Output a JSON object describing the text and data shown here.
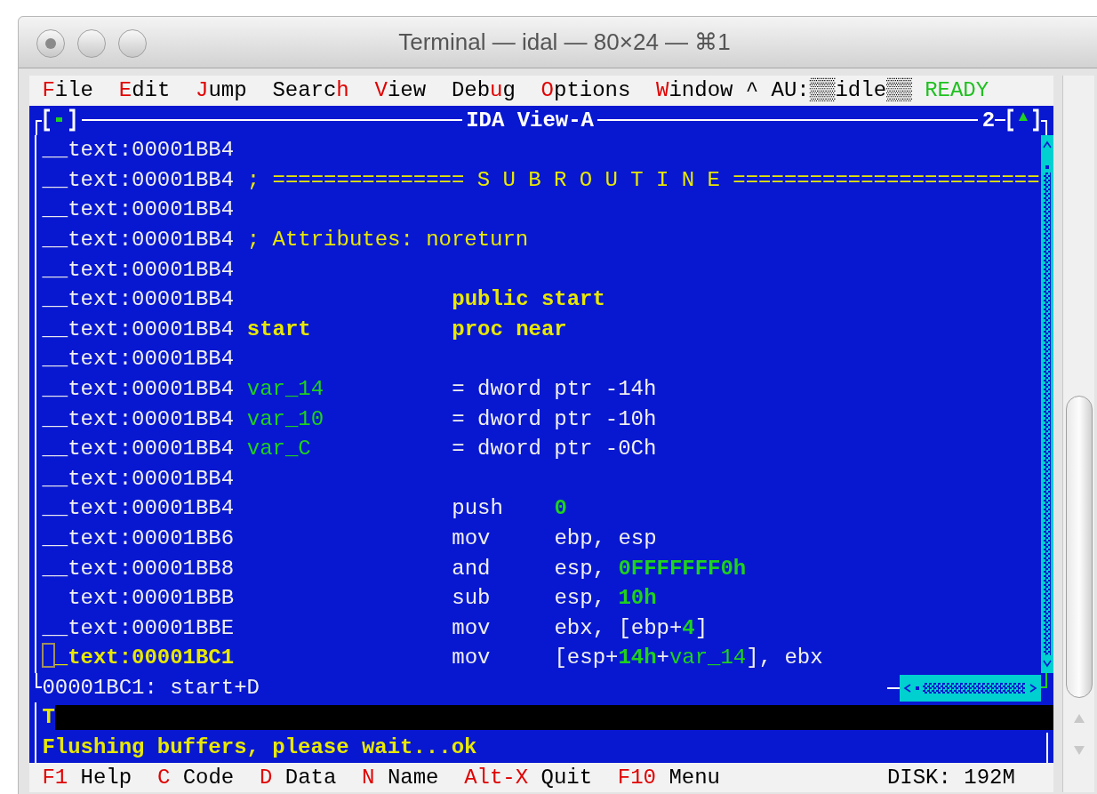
{
  "window": {
    "title": "Terminal — idal — 80×24 — ⌘1"
  },
  "menu": [
    {
      "key": "F",
      "post": "ile"
    },
    {
      "key": "E",
      "post": "dit"
    },
    {
      "key": "J",
      "post": "ump"
    },
    {
      "pre": "Searc",
      "key": "h"
    },
    {
      "key": "V",
      "post": "iew"
    },
    {
      "pre": "Deb",
      "key": "u",
      "post": "g"
    },
    {
      "key": "O",
      "post": "ptions"
    },
    {
      "key": "W",
      "post": "indow"
    }
  ],
  "auto_analysis": "^ AU:▒▒idle▒▒",
  "state": "READY",
  "view": {
    "title": "IDA View-A",
    "window_number": "2"
  },
  "rows": [
    {
      "address": "__text:00001BB4",
      "current": false
    },
    {
      "address": "__text:00001BB4",
      "current": false,
      "comment": "; =============== S U B R O U T I N E ========================"
    },
    {
      "address": "__text:00001BB4",
      "current": false
    },
    {
      "address": "__text:00001BB4",
      "current": false,
      "comment": "; Attributes: noreturn"
    },
    {
      "address": "__text:00001BB4",
      "current": false
    },
    {
      "address": "__text:00001BB4",
      "current": false,
      "directive": [
        {
          "text": "public start",
          "kind": "name"
        }
      ]
    },
    {
      "address": "__text:00001BB4",
      "current": false,
      "label": {
        "text": "start",
        "kind": "name"
      },
      "directive": [
        {
          "text": "proc near",
          "kind": "name"
        }
      ]
    },
    {
      "address": "__text:00001BB4",
      "current": false
    },
    {
      "address": "__text:00001BB4",
      "current": false,
      "label": {
        "text": "var_14",
        "kind": "var"
      },
      "directive": [
        {
          "text": "= dword ptr -14h",
          "kind": "plain"
        }
      ]
    },
    {
      "address": "__text:00001BB4",
      "current": false,
      "label": {
        "text": "var_10",
        "kind": "var"
      },
      "directive": [
        {
          "text": "= dword ptr -10h",
          "kind": "plain"
        }
      ]
    },
    {
      "address": "__text:00001BB4",
      "current": false,
      "label": {
        "text": "var_C",
        "kind": "var"
      },
      "directive": [
        {
          "text": "= dword ptr -0Ch",
          "kind": "plain"
        }
      ]
    },
    {
      "address": "__text:00001BB4",
      "current": false
    },
    {
      "address": "__text:00001BB4",
      "current": false,
      "mnemonic": "push",
      "operands": [
        {
          "text": "0",
          "kind": "number"
        }
      ]
    },
    {
      "address": "__text:00001BB6",
      "current": false,
      "mnemonic": "mov",
      "operands": [
        {
          "text": "ebp, esp",
          "kind": "plain"
        }
      ]
    },
    {
      "address": "__text:00001BB8",
      "current": false,
      "mnemonic": "and",
      "operands": [
        {
          "text": "esp, ",
          "kind": "plain"
        },
        {
          "text": "0FFFFFFF0h",
          "kind": "number"
        }
      ]
    },
    {
      "address": "  text:00001BBB",
      "current": false,
      "mnemonic": "sub",
      "operands": [
        {
          "text": "esp, ",
          "kind": "plain"
        },
        {
          "text": "10h",
          "kind": "number"
        }
      ]
    },
    {
      "address": "__text:00001BBE",
      "current": false,
      "mnemonic": "mov",
      "operands": [
        {
          "text": "ebx, [ebp+",
          "kind": "plain"
        },
        {
          "text": "4",
          "kind": "number"
        },
        {
          "text": "]",
          "kind": "plain"
        }
      ]
    },
    {
      "address": "_text:00001BC1",
      "current": true,
      "mnemonic": "mov",
      "operands": [
        {
          "text": "[esp+",
          "kind": "plain"
        },
        {
          "text": "14h",
          "kind": "number"
        },
        {
          "text": "+",
          "kind": "plain"
        },
        {
          "text": "var_14",
          "kind": "var"
        },
        {
          "text": "], ebx",
          "kind": "plain"
        }
      ]
    }
  ],
  "location": "00001BC1: start+D",
  "output": {
    "prompt": "T",
    "message": "Flushing buffers, please wait...ok"
  },
  "footer": [
    {
      "key": "F1",
      "label": "Help"
    },
    {
      "key": "C",
      "label": "Code"
    },
    {
      "key": "D",
      "label": "Data"
    },
    {
      "key": "N",
      "label": "Name"
    },
    {
      "key": "Alt-X",
      "label": "Quit"
    },
    {
      "key": "F10",
      "label": "Menu"
    }
  ],
  "disk": "DISK: 192M"
}
